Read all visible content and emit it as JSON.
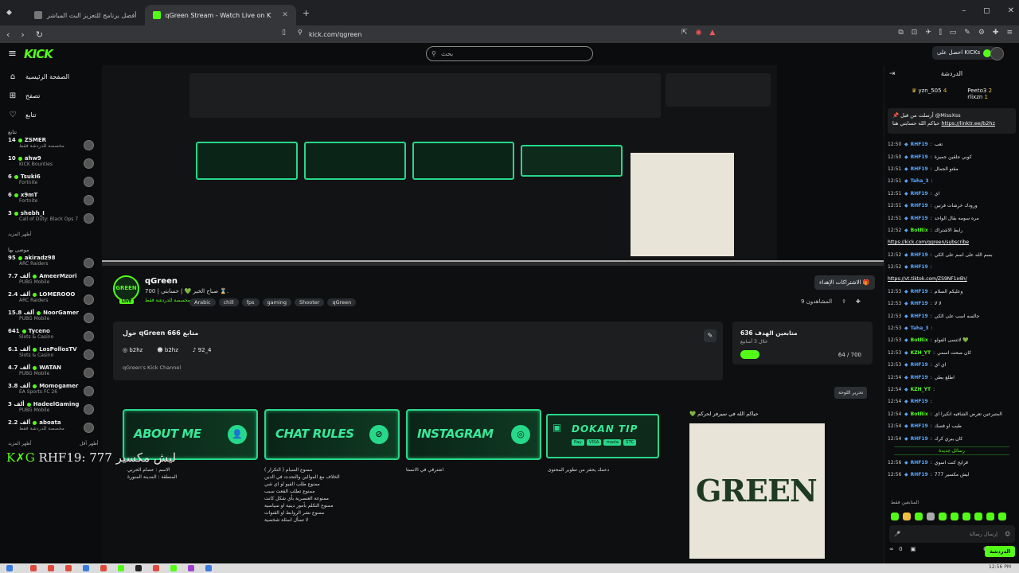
{
  "browser": {
    "tabs": [
      {
        "label": "أفضل برنامج للتعزيز البث المباشر",
        "active": false
      },
      {
        "label": "qGreen Stream - Watch Live on K",
        "active": true
      }
    ],
    "new_tab": "+",
    "url": "kick.com/qgreen",
    "window_controls": {
      "min": "–",
      "max": "◻",
      "close": "✕"
    }
  },
  "topnav": {
    "logo": "KICK",
    "search_placeholder": "بحث",
    "get_kicks": "احصل على KICKs"
  },
  "sidebar": {
    "nav": [
      {
        "label": "الصفحة الرئيسية",
        "icon": "home-icon"
      },
      {
        "label": "تصفح",
        "icon": "browse-icon"
      },
      {
        "label": "تتابع",
        "icon": "heart-icon"
      }
    ],
    "following_heading": "تتابع",
    "following": [
      {
        "name": "ZSMER",
        "count": "14",
        "game": "مخصصة للدردشة فقط"
      },
      {
        "name": "ahw9",
        "count": "10",
        "game": "KICK Bounties"
      },
      {
        "name": "Tsuki6",
        "count": "6",
        "game": "Fortnite"
      },
      {
        "name": "x9mT",
        "count": "6",
        "game": "Fortnite"
      },
      {
        "name": "shebh_I",
        "count": "3",
        "game": "Call of Duty: Black Ops 7"
      }
    ],
    "show_more_1": "أظهر المزيد",
    "recommended_heading": "موصى بها",
    "recommended": [
      {
        "name": "akiradz98",
        "count": "95",
        "game": "ARC Raiders"
      },
      {
        "name": "AmeerMzori",
        "count": "7.7 ألف",
        "game": "PUBG Mobile"
      },
      {
        "name": "LOMEROOO",
        "count": "2.4 ألف",
        "game": "ARC Raiders"
      },
      {
        "name": "NoorGamer",
        "count": "15.8 ألف",
        "game": "PUBG Mobile"
      },
      {
        "name": "Tyceno",
        "count": "641",
        "game": "Slots & Casino"
      },
      {
        "name": "LosPollosTV",
        "count": "6.1 ألف",
        "game": "Slots & Casino"
      },
      {
        "name": "WATAN",
        "count": "4.7 ألف",
        "game": "PUBG Mobile"
      },
      {
        "name": "Momogamer",
        "count": "3.8 ألف",
        "game": "EA Sports FC 26"
      },
      {
        "name": "HadeelGaming",
        "count": "3 ألف",
        "game": "PUBG Mobile"
      },
      {
        "name": "aboata",
        "count": "2.2 ألف",
        "game": "مخصصة للدردشة فقط"
      }
    ],
    "show_more_2": "أظهر المزيد",
    "show_less": "أظهر أقل"
  },
  "channel": {
    "name": "qGreen",
    "avatar_text": "GREEN",
    "live_badge": "LIVE",
    "title": "صباح الخير 💚 | حسابتي | 700 ⌛.",
    "category": "مخصصة للدردشة فقط",
    "tags": [
      "Arabic",
      "chill",
      "fps",
      "gaming",
      "Shooter",
      "qGreen"
    ],
    "subscribe_gifts": "الاشتراكات الإهداء",
    "viewers": "المشاهدون 9",
    "about_title": "حول qGreen  666 متابع",
    "socials": [
      "b2hz",
      "b2hz",
      "92_4"
    ],
    "description": "qGreen's Kick Channel",
    "goal_title": "متابعين الهدف 636",
    "goal_sub": "خلال 3 أسابيع",
    "goal_count": "64 / 700",
    "edit_panels": "تحرير اللوحة",
    "ticker": "RHF19: 777 ليش مكسير",
    "ticker_prefix": "K✗G"
  },
  "panels": [
    {
      "label": "ABOUT ME",
      "desc": [
        "الاسم : عصام الحربي",
        "المنطقة : المدينة المنورة"
      ]
    },
    {
      "label": "CHAT RULES",
      "desc": [
        "ممنوع السبام ( التكرار )",
        "الخلاف مع الموالين والتحدث في الدين",
        "ممنوع طلب الفيو او اي شي",
        "ممنوع تطلب الفعت سبب",
        "ممنوعة العنصرية بأي شكل كانت",
        "ممنوع التكلم بأمور دينية او سياسية",
        "ممنوع نشر الروابط او القنوات",
        "لا تسأل اسئلة شخصية"
      ]
    },
    {
      "label": "INSTAGRAM",
      "desc": [
        "اشترقي في الانستا"
      ]
    },
    {
      "label": "DOKAN TIP",
      "desc": [
        "دعمك يحفز من تطوير المحتوى"
      ]
    }
  ],
  "dokan_pay": [
    "Pay",
    "VISA",
    "mada",
    "STC"
  ],
  "green_caption": "💚 حياكم الله في سيرفر لحركم",
  "green_image_text": "GREEN",
  "chat": {
    "title": "الدردشة",
    "gifters": [
      {
        "name": "yzn_505",
        "count": "4"
      },
      {
        "name": "Peeto3",
        "count": "2"
      },
      {
        "name": "rlixzn",
        "count": "1"
      }
    ],
    "pinned_user": "@MissXss",
    "pinned_line1": "أرسلت من قبل",
    "pinned_text": "حياكم الله حسابتي هنا",
    "pinned_link": "https://linktr.ee/b2hz",
    "messages": [
      {
        "time": "12:50",
        "user": "RHF19",
        "color": "#5aa8ff",
        "text": "تعب"
      },
      {
        "time": "12:50",
        "user": "RHF19",
        "color": "#5aa8ff",
        "text": "كوبي جلقين جميزة"
      },
      {
        "time": "12:51",
        "user": "RHF19",
        "color": "#5aa8ff",
        "text": "مقتو الجمال"
      },
      {
        "time": "12:51",
        "user": "Taha_3",
        "color": "#5aa8ff",
        "text": ""
      },
      {
        "time": "12:51",
        "user": "RHF19",
        "color": "#5aa8ff",
        "text": "اي"
      },
      {
        "time": "12:51",
        "user": "RHF19",
        "color": "#5aa8ff",
        "text": "ورودك خرشات فرنين"
      },
      {
        "time": "12:51",
        "user": "RHF19",
        "color": "#5aa8ff",
        "text": "مره سومه بقال الواحد"
      },
      {
        "time": "12:52",
        "user": "BotRix",
        "color": "#53fc18",
        "text": "رابط الاشتراك"
      },
      {
        "time": "",
        "user": "",
        "color": "#fff",
        "text": "https://kick.com/qgreen/subscribe",
        "link": true
      },
      {
        "time": "12:52",
        "user": "RHF19",
        "color": "#5aa8ff",
        "text": "بسم الله على اسم على الكي"
      },
      {
        "time": "12:52",
        "user": "RHF19",
        "color": "#5aa8ff",
        "text": ""
      },
      {
        "time": "",
        "user": "",
        "color": "#fff",
        "text": "https://vt.tiktok.com/ZS9NF1x6h/",
        "link": true
      },
      {
        "time": "12:53",
        "user": "RHF19",
        "color": "#5aa8ff",
        "text": "وعليكم السلام"
      },
      {
        "time": "12:53",
        "user": "RHF19",
        "color": "#5aa8ff",
        "text": "لا لا"
      },
      {
        "time": "12:53",
        "user": "RHF19",
        "color": "#5aa8ff",
        "text": "جالسه اسب على الكي"
      },
      {
        "time": "12:53",
        "user": "Taha_3",
        "color": "#5aa8ff",
        "text": ""
      },
      {
        "time": "12:53",
        "user": "BotRix",
        "color": "#53fc18",
        "text": "لاتنسى الفولو 💚"
      },
      {
        "time": "12:53",
        "user": "KZH_YT",
        "color": "#53fc18",
        "text": "كان صحت اسمي"
      },
      {
        "time": "12:53",
        "user": "RHF19",
        "color": "#5aa8ff",
        "text": "اي اي"
      },
      {
        "time": "12:54",
        "user": "RHF19",
        "color": "#5aa8ff",
        "text": "اطلع بطي"
      },
      {
        "time": "12:54",
        "user": "KZH_YT",
        "color": "#53fc18",
        "text": ""
      },
      {
        "time": "12:54",
        "user": "RHF19",
        "color": "#5aa8ff",
        "text": ""
      },
      {
        "time": "12:54",
        "user": "BotRix",
        "color": "#53fc18",
        "text": "المتبرعين تعرض الشافيه انكيرا اي"
      },
      {
        "time": "12:54",
        "user": "RHF19",
        "color": "#5aa8ff",
        "text": "طيب او فسك"
      },
      {
        "time": "12:54",
        "user": "RHF19",
        "color": "#5aa8ff",
        "text": "كان يبري كرك"
      }
    ],
    "new_messages": "رسائل جديدة",
    "after_messages": [
      {
        "time": "12:56",
        "user": "RHF19",
        "color": "#5aa8ff",
        "text": "قرايح كنت اسوي"
      },
      {
        "time": "12:56",
        "user": "RHF19",
        "color": "#5aa8ff",
        "text": "ليش مكسير 777"
      }
    ],
    "emotes_label": "المتابعين فقط",
    "input_placeholder": "إرسال رسالة",
    "footer_count": "0",
    "chat_button": "الدردشة"
  },
  "taskbar": {
    "clock": "12:56 PM"
  }
}
